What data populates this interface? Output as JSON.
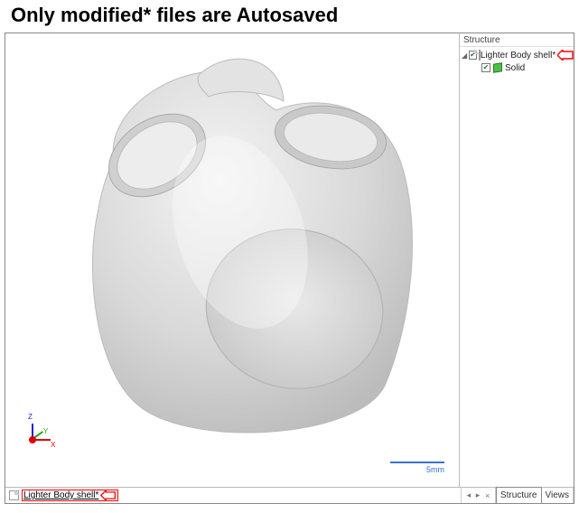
{
  "title": "Only modified* files are Autosaved",
  "structure_panel": {
    "header": "Structure",
    "root": {
      "checked": true,
      "label": "Lighter Body shell*"
    },
    "child": {
      "checked": true,
      "label": "Solid"
    }
  },
  "viewport": {
    "scale_label": "5mm",
    "axes": {
      "x": "X",
      "y": "Y",
      "z": "Z"
    }
  },
  "bottom_bar": {
    "document_tab": "Lighter Body shell*",
    "nav_prev": "◂",
    "nav_next": "▸",
    "nav_close": "×",
    "panel_tabs": {
      "structure": "Structure",
      "views": "Views"
    }
  }
}
